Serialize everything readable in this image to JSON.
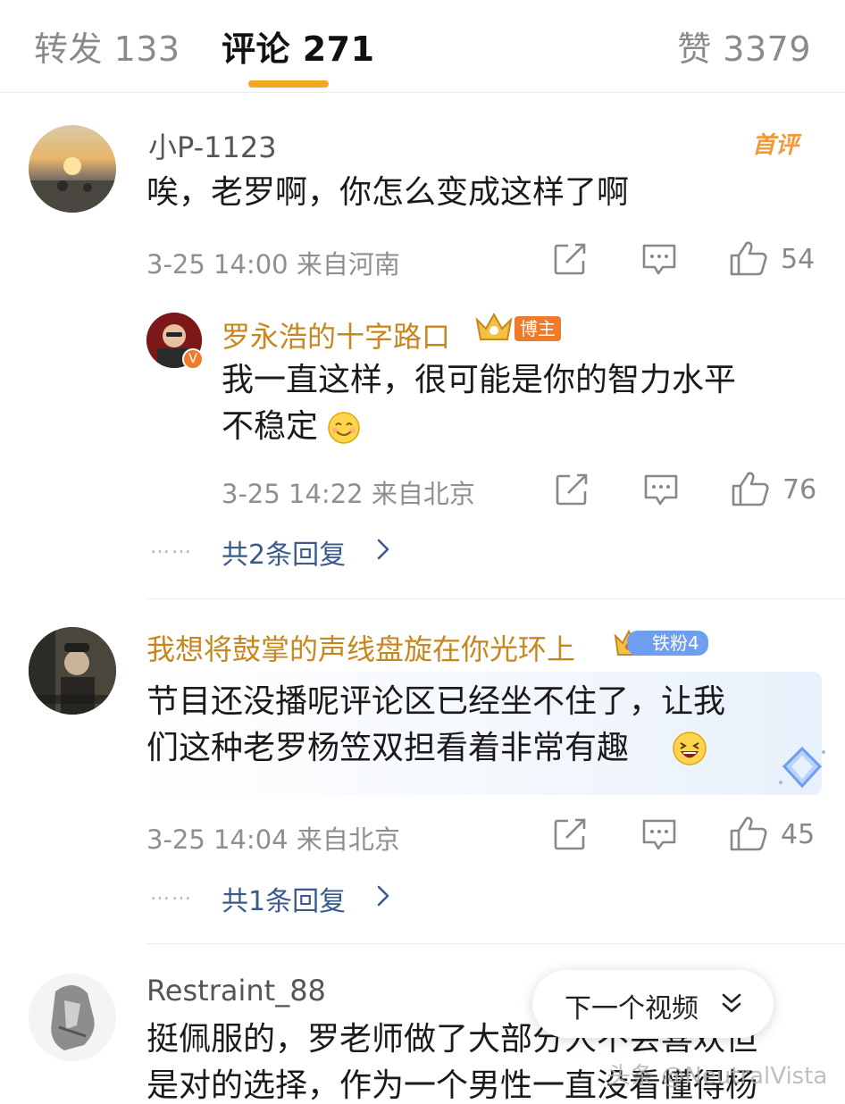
{
  "tabs": {
    "forward": "转发 133",
    "comment": "评论 271",
    "like": "赞 3379"
  },
  "comments": [
    {
      "username": "小P-1123",
      "badge": "首评",
      "content": "唉，老罗啊，你怎么变成这样了啊",
      "meta": "3-25 14:00 来自河南",
      "likes": "54",
      "reply": {
        "username": "罗永浩的十字路口",
        "badge": "博主",
        "content_line1": "我一直这样，很可能是你的智力水平",
        "content_line2": "不稳定",
        "meta": "3-25 14:22 来自北京",
        "likes": "76"
      },
      "more_replies": "共2条回复",
      "more_dots": "……"
    },
    {
      "username": "我想将鼓掌的声线盘旋在你光环上",
      "badge": "铁粉4",
      "content_line1": "节目还没播呢评论区已经坐不住了，让我",
      "content_line2": "们这种老罗杨笠双担看着非常有趣",
      "meta": "3-25 14:04 来自北京",
      "likes": "45",
      "more_replies": "共1条回复",
      "more_dots": "……"
    },
    {
      "username": "Restraint_88",
      "content_line1": "挺佩服的，罗老师做了大部分人不会喜欢但",
      "content_line2": "是对的选择，作为一个男性一直没看懂得杨"
    }
  ],
  "next_video": "下一个视频",
  "watermark": "头条 @NeutralVista",
  "colors": {
    "accent": "#f5a623",
    "link": "#3a5a8c",
    "username_highlight": "#c8861f"
  },
  "icons": [
    "share-icon",
    "comment-icon",
    "thumbs-up-icon",
    "chevron-right-icon",
    "chevron-down-icon",
    "crown-icon",
    "verified-icon"
  ]
}
